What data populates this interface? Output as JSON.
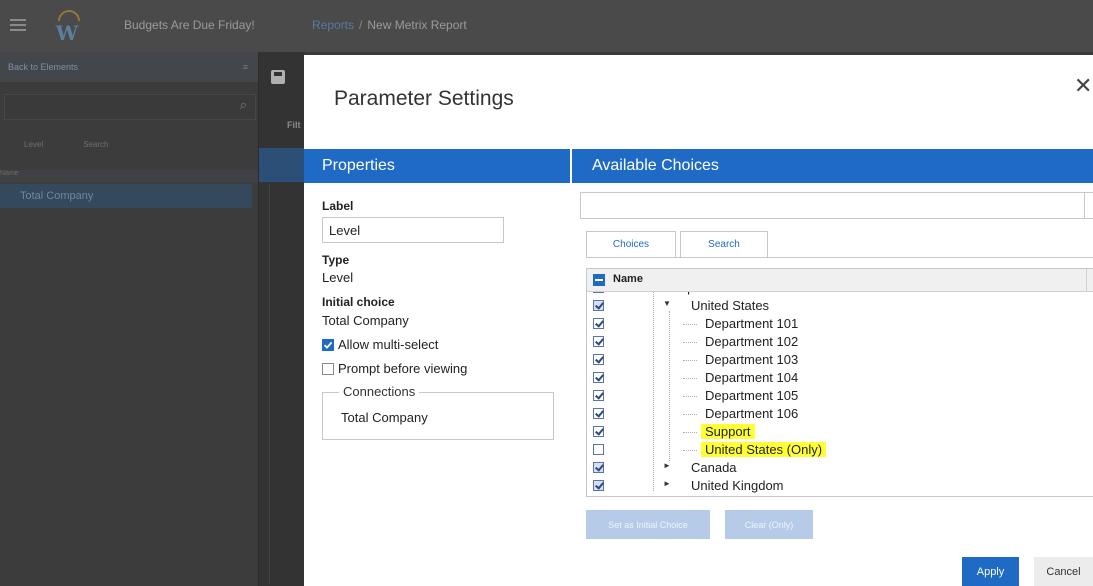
{
  "app": {
    "title": "Budgets Are Due Friday!",
    "logo_letter": "W",
    "breadcrumbs": [
      {
        "label": "Reports",
        "is_link": true
      },
      {
        "label": "New Metrix Report",
        "is_link": false
      }
    ],
    "breadcrumb_separator": "/"
  },
  "left_panel": {
    "header": "Back to Elements",
    "menu_icon": "menu-icon",
    "tabs": [
      "Level",
      "Search"
    ],
    "sub_header": "Name",
    "selected_item": "Total Company"
  },
  "strip": {
    "filter_label": "Filt"
  },
  "dialog": {
    "title": "Parameter Settings",
    "close_glyph": "✕",
    "properties": {
      "header": "Properties",
      "label_caption": "Label",
      "label_value": "Level",
      "type_caption": "Type",
      "type_value": "Level",
      "initial_choice_caption": "Initial choice",
      "initial_choice_value": "Total Company",
      "allow_multi_select": {
        "label": "Allow multi-select",
        "checked": true
      },
      "prompt_before_viewing": {
        "label": "Prompt before viewing",
        "checked": false
      },
      "connections_legend": "Connections",
      "connections_value": "Total Company"
    },
    "available_choices": {
      "header": "Available Choices",
      "search_value": "",
      "tabs": [
        {
          "label": "Choices",
          "active": true
        },
        {
          "label": "Search",
          "active": false
        }
      ],
      "column_header": "Name",
      "rows": [
        {
          "label": "Operations",
          "checked": "partial",
          "expander": "",
          "highlight": false
        },
        {
          "label": "United States",
          "checked": "partial",
          "expander": "▼",
          "highlight": false
        },
        {
          "label": "Department 101",
          "checked": "checked",
          "expander": "",
          "highlight": false
        },
        {
          "label": "Department 102",
          "checked": "checked",
          "expander": "",
          "highlight": false
        },
        {
          "label": "Department 103",
          "checked": "checked",
          "expander": "",
          "highlight": false
        },
        {
          "label": "Department 104",
          "checked": "checked",
          "expander": "",
          "highlight": false
        },
        {
          "label": "Department 105",
          "checked": "checked",
          "expander": "",
          "highlight": false
        },
        {
          "label": "Department 106",
          "checked": "checked",
          "expander": "",
          "highlight": false
        },
        {
          "label": "Support",
          "checked": "checked",
          "expander": "",
          "highlight": true
        },
        {
          "label": "United States (Only)",
          "checked": "unchecked",
          "expander": "",
          "highlight": true
        },
        {
          "label": "Canada",
          "checked": "partial",
          "expander": "►",
          "highlight": false
        },
        {
          "label": "United Kingdom",
          "checked": "partial",
          "expander": "►",
          "highlight": false
        }
      ],
      "set_initial_button": "Set as Initial Choice",
      "clear_button": "Clear (Only)"
    },
    "apply_button": "Apply",
    "cancel_button": "Cancel"
  },
  "colors": {
    "accent": "#1f6ac4",
    "highlight": "#ffff33",
    "disabled_button": "#b6cbe8"
  }
}
